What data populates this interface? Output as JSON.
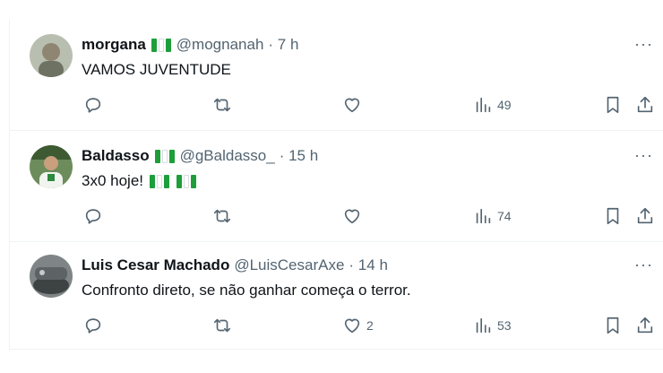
{
  "tweets": [
    {
      "name": "morgana",
      "handle": "@mognanah",
      "time": "· 7 h",
      "text": "VAMOS JUVENTUDE",
      "likes": "",
      "views": "49",
      "name_flag": true,
      "text_flag": false,
      "avatar_colors": [
        "#9aa595",
        "#c9c7b8"
      ]
    },
    {
      "name": "Baldasso",
      "handle": "@gBaldasso_",
      "time": "· 15 h",
      "text": "3x0 hoje!",
      "likes": "",
      "views": "74",
      "name_flag": true,
      "text_flag": true,
      "avatar_colors": [
        "#4f7a3a",
        "#d9e2d0"
      ]
    },
    {
      "name": "Luis Cesar Machado",
      "handle": "@LuisCesarAxe",
      "time": "· 14 h",
      "text": "Confronto direto, se não ganhar começa o terror.",
      "likes": "2",
      "views": "53",
      "name_flag": false,
      "text_flag": false,
      "avatar_colors": [
        "#4b4f50",
        "#9ea4a6"
      ]
    }
  ],
  "icons": {
    "more": "more-icon",
    "reply": "reply-icon",
    "retweet": "retweet-icon",
    "like": "heart-icon",
    "views": "analytics-icon",
    "bookmark": "bookmark-icon",
    "share": "share-icon"
  },
  "colors": {
    "text": "#0f1419",
    "secondary": "#536471",
    "divider": "#eff3f4",
    "flag_green": "#1e9e3a"
  }
}
